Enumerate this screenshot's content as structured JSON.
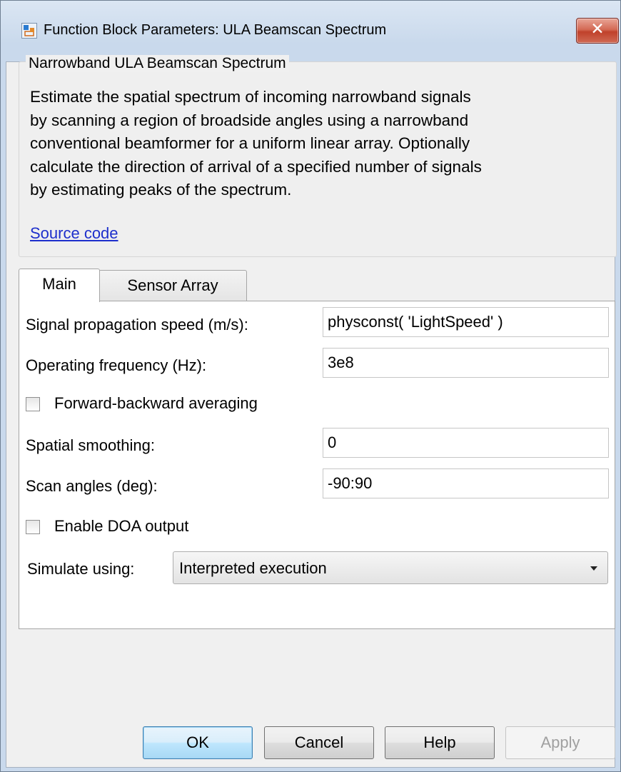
{
  "window": {
    "title": "Function Block Parameters: ULA Beamscan Spectrum",
    "close_symbol": "✕"
  },
  "group": {
    "title": "Narrowband ULA Beamscan Spectrum",
    "description": "Estimate the spatial spectrum of incoming narrowband signals\nby scanning a region of broadside angles using a narrowband\nconventional beamformer for a uniform linear array. Optionally\ncalculate the direction of arrival of a specified number of signals\nby estimating peaks of the spectrum.",
    "source_link": "Source code"
  },
  "tabs": [
    {
      "label": "Main",
      "active": true
    },
    {
      "label": "Sensor Array",
      "active": false
    }
  ],
  "params": {
    "propagation_speed_label": "Signal propagation speed (m/s):",
    "propagation_speed_value": "physconst( 'LightSpeed' )",
    "operating_frequency_label": "Operating frequency (Hz):",
    "operating_frequency_value": "3e8",
    "fb_averaging_label": "Forward-backward averaging",
    "fb_averaging_checked": false,
    "spatial_smoothing_label": "Spatial smoothing:",
    "spatial_smoothing_value": "0",
    "scan_angles_label": "Scan angles (deg):",
    "scan_angles_value": "-90:90",
    "doa_output_label": "Enable DOA output",
    "doa_output_checked": false,
    "simulate_label": "Simulate using:",
    "simulate_value": "Interpreted execution"
  },
  "buttons": {
    "ok": "OK",
    "cancel": "Cancel",
    "help": "Help",
    "apply": "Apply"
  },
  "colors": {
    "link": "#1d2fcc",
    "close_button": "#c0412b",
    "default_button": "#bee6fd"
  },
  "icons": {
    "title": "simulink-block-icon",
    "close": "close-icon",
    "dropdown": "chevron-down-icon"
  }
}
